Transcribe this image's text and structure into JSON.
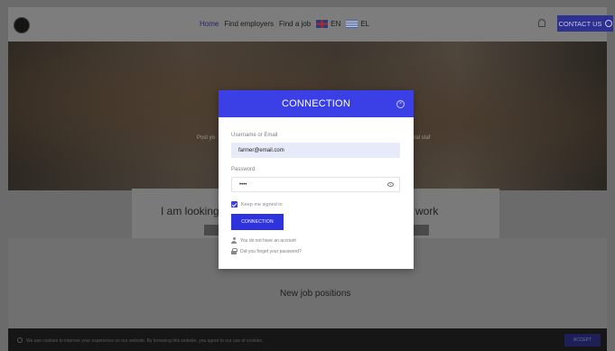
{
  "header": {
    "nav": [
      {
        "label": "Home",
        "active": true
      },
      {
        "label": "Find employers",
        "active": false
      },
      {
        "label": "Find a job",
        "active": false
      }
    ],
    "languages": [
      {
        "label": "EN",
        "flag": "uk-flag-icon"
      },
      {
        "label": "EL",
        "flag": "greece-flag-icon"
      }
    ],
    "contact_label": "CONTACT US"
  },
  "hero": {
    "left_text": "Post yo",
    "right_text": "ural staf"
  },
  "panels": {
    "looking": "I am looking",
    "work": "work",
    "new_jobs": "New job positions"
  },
  "modal": {
    "title": "CONNECTION",
    "username_label": "Username or Email",
    "username_value": "farmer@email.com",
    "password_label": "Password",
    "password_value": "••••",
    "keep_signed_in": "Keep me signed in",
    "keep_checked": true,
    "submit_label": "CONNECTION",
    "no_account_link": "You do not have an account",
    "forgot_link": "Did you forget your password?"
  },
  "cookie": {
    "text": "We use cookies to improve your experience on our website. By browsing this website, you agree to our use of cookies.",
    "accept_label": "ACCEPT"
  },
  "colors": {
    "brand_blue": "#3b3fe6",
    "contact_button": "#2f3190",
    "input_fill": "#e7eaf8"
  }
}
